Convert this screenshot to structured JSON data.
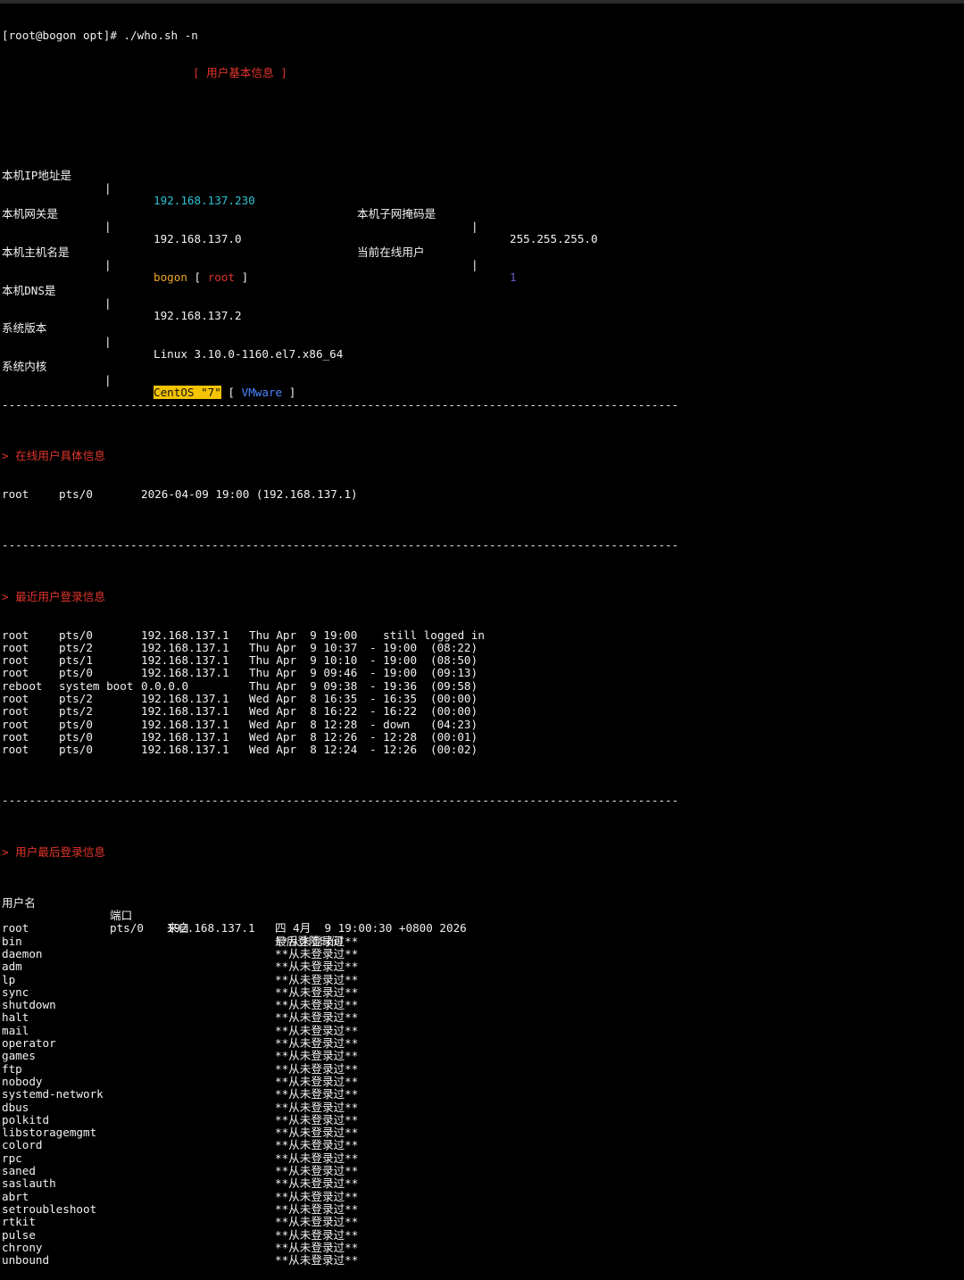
{
  "prompt_line": "[root@bogon opt]# ./who.sh -n",
  "header_title": "[ 用户基本信息 ]",
  "separator": "----------------------------------------------------------------------------------------------------",
  "info": {
    "ip_label": "本机IP地址是",
    "ip_value": "192.168.137.230",
    "mask_label": "本机子网掩码是",
    "mask_value": "255.255.255.0",
    "gateway_label": "本机网关是",
    "gateway_value": "192.168.137.0",
    "online_label": "当前在线用户",
    "online_value": "1",
    "hostname_label": "本机主机名是",
    "hostname_value": "bogon",
    "hostname_bracket_open": "[",
    "hostname_user": "root",
    "hostname_bracket_close": "]",
    "dns_label": "本机DNS是",
    "dns_value": "192.168.137.2",
    "version_label": "系统版本",
    "version_value": "Linux 3.10.0-1160.el7.x86_64",
    "kernel_label": "系统内核",
    "kernel_os": "CentOS \"7\"",
    "kernel_bracket_open": "[",
    "kernel_virt": "VMware",
    "kernel_bracket_close": "]",
    "pipe": "|"
  },
  "online_section": {
    "title": "> 在线用户具体信息",
    "rows": [
      {
        "user": "root",
        "tty": "pts/0",
        "info": "2026-04-09 19:00 (192.168.137.1)"
      }
    ]
  },
  "recent_section": {
    "title": "> 最近用户登录信息",
    "rows": [
      {
        "user": "root",
        "tty": "pts/0",
        "host": "192.168.137.1",
        "date": "Thu Apr  9 19:00",
        "span": "  still logged in",
        "dur": ""
      },
      {
        "user": "root",
        "tty": "pts/2",
        "host": "192.168.137.1",
        "date": "Thu Apr  9 10:37",
        "span": "- 19:00",
        "dur": "(08:22)"
      },
      {
        "user": "root",
        "tty": "pts/1",
        "host": "192.168.137.1",
        "date": "Thu Apr  9 10:10",
        "span": "- 19:00",
        "dur": "(08:50)"
      },
      {
        "user": "root",
        "tty": "pts/0",
        "host": "192.168.137.1",
        "date": "Thu Apr  9 09:46",
        "span": "- 19:00",
        "dur": "(09:13)"
      },
      {
        "user": "reboot",
        "tty": "system boot",
        "host": "0.0.0.0",
        "date": "Thu Apr  9 09:38",
        "span": "- 19:36",
        "dur": "(09:58)"
      },
      {
        "user": "root",
        "tty": "pts/2",
        "host": "192.168.137.1",
        "date": "Wed Apr  8 16:35",
        "span": "- 16:35",
        "dur": "(00:00)"
      },
      {
        "user": "root",
        "tty": "pts/2",
        "host": "192.168.137.1",
        "date": "Wed Apr  8 16:22",
        "span": "- 16:22",
        "dur": "(00:00)"
      },
      {
        "user": "root",
        "tty": "pts/0",
        "host": "192.168.137.1",
        "date": "Wed Apr  8 12:28",
        "span": "- down",
        "dur": "(04:23)"
      },
      {
        "user": "root",
        "tty": "pts/0",
        "host": "192.168.137.1",
        "date": "Wed Apr  8 12:26",
        "span": "- 12:28",
        "dur": "(00:01)"
      },
      {
        "user": "root",
        "tty": "pts/0",
        "host": "192.168.137.1",
        "date": "Wed Apr  8 12:24",
        "span": "- 12:26",
        "dur": "(00:02)"
      }
    ]
  },
  "lastlog_section": {
    "title": "> 用户最后登录信息",
    "headers": {
      "user": "用户名",
      "port": "端口",
      "from": "来自",
      "latest": "最后登陆时间"
    },
    "rows": [
      {
        "user": "root",
        "port": "pts/0",
        "from": "192.168.137.1",
        "latest": "四 4月  9 19:00:30 +0800 2026"
      },
      {
        "user": "bin",
        "port": "",
        "from": "",
        "latest": "**从未登录过**"
      },
      {
        "user": "daemon",
        "port": "",
        "from": "",
        "latest": "**从未登录过**"
      },
      {
        "user": "adm",
        "port": "",
        "from": "",
        "latest": "**从未登录过**"
      },
      {
        "user": "lp",
        "port": "",
        "from": "",
        "latest": "**从未登录过**"
      },
      {
        "user": "sync",
        "port": "",
        "from": "",
        "latest": "**从未登录过**"
      },
      {
        "user": "shutdown",
        "port": "",
        "from": "",
        "latest": "**从未登录过**"
      },
      {
        "user": "halt",
        "port": "",
        "from": "",
        "latest": "**从未登录过**"
      },
      {
        "user": "mail",
        "port": "",
        "from": "",
        "latest": "**从未登录过**"
      },
      {
        "user": "operator",
        "port": "",
        "from": "",
        "latest": "**从未登录过**"
      },
      {
        "user": "games",
        "port": "",
        "from": "",
        "latest": "**从未登录过**"
      },
      {
        "user": "ftp",
        "port": "",
        "from": "",
        "latest": "**从未登录过**"
      },
      {
        "user": "nobody",
        "port": "",
        "from": "",
        "latest": "**从未登录过**"
      },
      {
        "user": "systemd-network",
        "port": "",
        "from": "",
        "latest": "**从未登录过**"
      },
      {
        "user": "dbus",
        "port": "",
        "from": "",
        "latest": "**从未登录过**"
      },
      {
        "user": "polkitd",
        "port": "",
        "from": "",
        "latest": "**从未登录过**"
      },
      {
        "user": "libstoragemgmt",
        "port": "",
        "from": "",
        "latest": "**从未登录过**"
      },
      {
        "user": "colord",
        "port": "",
        "from": "",
        "latest": "**从未登录过**"
      },
      {
        "user": "rpc",
        "port": "",
        "from": "",
        "latest": "**从未登录过**"
      },
      {
        "user": "saned",
        "port": "",
        "from": "",
        "latest": "**从未登录过**"
      },
      {
        "user": "saslauth",
        "port": "",
        "from": "",
        "latest": "**从未登录过**"
      },
      {
        "user": "abrt",
        "port": "",
        "from": "",
        "latest": "**从未登录过**"
      },
      {
        "user": "setroubleshoot",
        "port": "",
        "from": "",
        "latest": "**从未登录过**"
      },
      {
        "user": "rtkit",
        "port": "",
        "from": "",
        "latest": "**从未登录过**"
      },
      {
        "user": "pulse",
        "port": "",
        "from": "",
        "latest": "**从未登录过**"
      },
      {
        "user": "chrony",
        "port": "",
        "from": "",
        "latest": "**从未登录过**"
      },
      {
        "user": "unbound",
        "port": "",
        "from": "",
        "latest": "**从未登录过**"
      }
    ]
  },
  "colors": {
    "background": "#000000",
    "foreground": "#f2f2f2",
    "accent_red": "#e0352b",
    "accent_cyan": "#2ec3d6",
    "accent_orange": "#f0a52b",
    "accent_blue": "#4a86ff",
    "highlight_yellow": "#f5c400"
  }
}
